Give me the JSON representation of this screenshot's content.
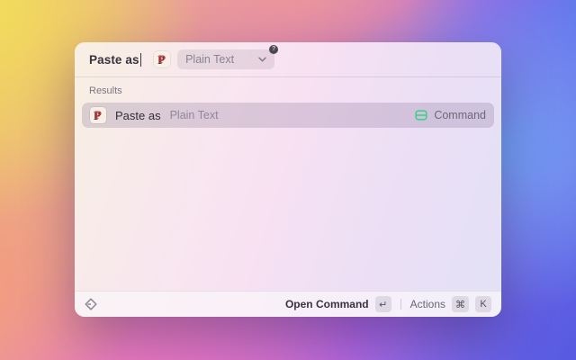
{
  "window": {
    "search": {
      "query": "Paste as",
      "app_icon_letter": "P",
      "argument": {
        "value": "Plain Text",
        "badge": "?"
      }
    },
    "results": {
      "section_label": "Results",
      "items": [
        {
          "icon_letter": "P",
          "title": "Paste as",
          "subtitle": "Plain Text",
          "type_icon": "command-type-icon",
          "accessory": "Command"
        }
      ]
    },
    "footer": {
      "primary_action": "Open Command",
      "primary_key": "↵",
      "secondary_action": "Actions",
      "secondary_keys": [
        "⌘",
        "K"
      ]
    },
    "colors": {
      "accent_green": "#3ecf8e",
      "selected_row_bg": "#cfc3d4",
      "footer_bg": "#f4f0f4"
    }
  }
}
